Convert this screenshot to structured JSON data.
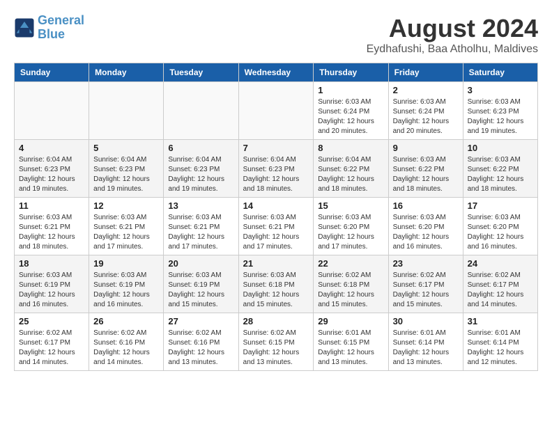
{
  "header": {
    "logo_line1": "General",
    "logo_line2": "Blue",
    "title": "August 2024",
    "subtitle": "Eydhafushi, Baa Atholhu, Maldives"
  },
  "columns": [
    "Sunday",
    "Monday",
    "Tuesday",
    "Wednesday",
    "Thursday",
    "Friday",
    "Saturday"
  ],
  "weeks": [
    {
      "days": [
        {
          "num": "",
          "info": ""
        },
        {
          "num": "",
          "info": ""
        },
        {
          "num": "",
          "info": ""
        },
        {
          "num": "",
          "info": ""
        },
        {
          "num": "1",
          "info": "Sunrise: 6:03 AM\nSunset: 6:24 PM\nDaylight: 12 hours\nand 20 minutes."
        },
        {
          "num": "2",
          "info": "Sunrise: 6:03 AM\nSunset: 6:24 PM\nDaylight: 12 hours\nand 20 minutes."
        },
        {
          "num": "3",
          "info": "Sunrise: 6:03 AM\nSunset: 6:23 PM\nDaylight: 12 hours\nand 19 minutes."
        }
      ]
    },
    {
      "days": [
        {
          "num": "4",
          "info": "Sunrise: 6:04 AM\nSunset: 6:23 PM\nDaylight: 12 hours\nand 19 minutes."
        },
        {
          "num": "5",
          "info": "Sunrise: 6:04 AM\nSunset: 6:23 PM\nDaylight: 12 hours\nand 19 minutes."
        },
        {
          "num": "6",
          "info": "Sunrise: 6:04 AM\nSunset: 6:23 PM\nDaylight: 12 hours\nand 19 minutes."
        },
        {
          "num": "7",
          "info": "Sunrise: 6:04 AM\nSunset: 6:23 PM\nDaylight: 12 hours\nand 18 minutes."
        },
        {
          "num": "8",
          "info": "Sunrise: 6:04 AM\nSunset: 6:22 PM\nDaylight: 12 hours\nand 18 minutes."
        },
        {
          "num": "9",
          "info": "Sunrise: 6:03 AM\nSunset: 6:22 PM\nDaylight: 12 hours\nand 18 minutes."
        },
        {
          "num": "10",
          "info": "Sunrise: 6:03 AM\nSunset: 6:22 PM\nDaylight: 12 hours\nand 18 minutes."
        }
      ]
    },
    {
      "days": [
        {
          "num": "11",
          "info": "Sunrise: 6:03 AM\nSunset: 6:21 PM\nDaylight: 12 hours\nand 18 minutes."
        },
        {
          "num": "12",
          "info": "Sunrise: 6:03 AM\nSunset: 6:21 PM\nDaylight: 12 hours\nand 17 minutes."
        },
        {
          "num": "13",
          "info": "Sunrise: 6:03 AM\nSunset: 6:21 PM\nDaylight: 12 hours\nand 17 minutes."
        },
        {
          "num": "14",
          "info": "Sunrise: 6:03 AM\nSunset: 6:21 PM\nDaylight: 12 hours\nand 17 minutes."
        },
        {
          "num": "15",
          "info": "Sunrise: 6:03 AM\nSunset: 6:20 PM\nDaylight: 12 hours\nand 17 minutes."
        },
        {
          "num": "16",
          "info": "Sunrise: 6:03 AM\nSunset: 6:20 PM\nDaylight: 12 hours\nand 16 minutes."
        },
        {
          "num": "17",
          "info": "Sunrise: 6:03 AM\nSunset: 6:20 PM\nDaylight: 12 hours\nand 16 minutes."
        }
      ]
    },
    {
      "days": [
        {
          "num": "18",
          "info": "Sunrise: 6:03 AM\nSunset: 6:19 PM\nDaylight: 12 hours\nand 16 minutes."
        },
        {
          "num": "19",
          "info": "Sunrise: 6:03 AM\nSunset: 6:19 PM\nDaylight: 12 hours\nand 16 minutes."
        },
        {
          "num": "20",
          "info": "Sunrise: 6:03 AM\nSunset: 6:19 PM\nDaylight: 12 hours\nand 15 minutes."
        },
        {
          "num": "21",
          "info": "Sunrise: 6:03 AM\nSunset: 6:18 PM\nDaylight: 12 hours\nand 15 minutes."
        },
        {
          "num": "22",
          "info": "Sunrise: 6:02 AM\nSunset: 6:18 PM\nDaylight: 12 hours\nand 15 minutes."
        },
        {
          "num": "23",
          "info": "Sunrise: 6:02 AM\nSunset: 6:17 PM\nDaylight: 12 hours\nand 15 minutes."
        },
        {
          "num": "24",
          "info": "Sunrise: 6:02 AM\nSunset: 6:17 PM\nDaylight: 12 hours\nand 14 minutes."
        }
      ]
    },
    {
      "days": [
        {
          "num": "25",
          "info": "Sunrise: 6:02 AM\nSunset: 6:17 PM\nDaylight: 12 hours\nand 14 minutes."
        },
        {
          "num": "26",
          "info": "Sunrise: 6:02 AM\nSunset: 6:16 PM\nDaylight: 12 hours\nand 14 minutes."
        },
        {
          "num": "27",
          "info": "Sunrise: 6:02 AM\nSunset: 6:16 PM\nDaylight: 12 hours\nand 13 minutes."
        },
        {
          "num": "28",
          "info": "Sunrise: 6:02 AM\nSunset: 6:15 PM\nDaylight: 12 hours\nand 13 minutes."
        },
        {
          "num": "29",
          "info": "Sunrise: 6:01 AM\nSunset: 6:15 PM\nDaylight: 12 hours\nand 13 minutes."
        },
        {
          "num": "30",
          "info": "Sunrise: 6:01 AM\nSunset: 6:14 PM\nDaylight: 12 hours\nand 13 minutes."
        },
        {
          "num": "31",
          "info": "Sunrise: 6:01 AM\nSunset: 6:14 PM\nDaylight: 12 hours\nand 12 minutes."
        }
      ]
    }
  ]
}
